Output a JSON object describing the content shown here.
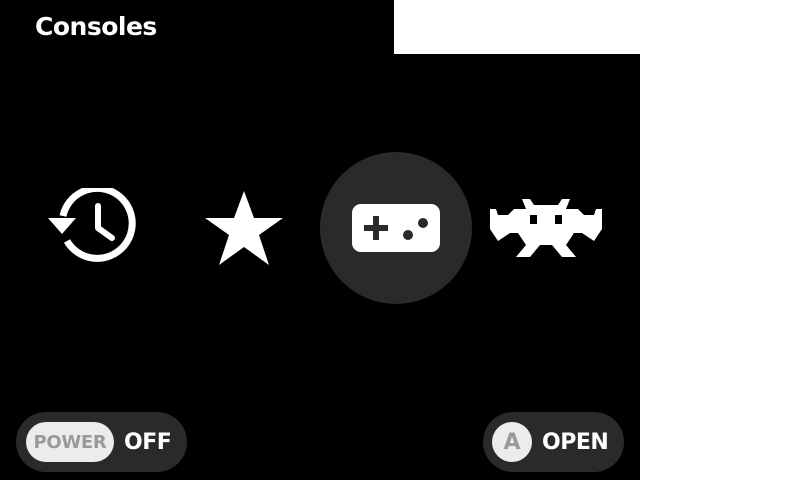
{
  "header": {
    "title": "Consoles"
  },
  "menu": {
    "items": [
      {
        "icon": "recent-history-icon",
        "selected": false
      },
      {
        "icon": "favorites-star-icon",
        "selected": false
      },
      {
        "icon": "gamepad-icon",
        "selected": true
      },
      {
        "icon": "retroarch-invader-icon",
        "selected": false
      }
    ]
  },
  "footer": {
    "power": {
      "button_label": "POWER",
      "action_label": "OFF"
    },
    "open": {
      "button_label": "A",
      "action_label": "OPEN"
    }
  },
  "colors": {
    "background": "#000000",
    "pill": "#2a2a2a",
    "selection": "#2a2a2a",
    "button_face": "#ececec",
    "button_text": "#9a9a9a",
    "text": "#ffffff"
  }
}
